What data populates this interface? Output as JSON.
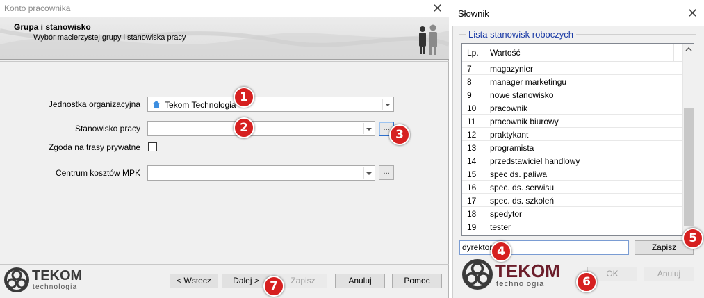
{
  "left_window": {
    "title": "Konto pracownika",
    "header": {
      "title": "Grupa i stanowisko",
      "subtitle": "Wybór macierzystej grupy i stanowiska pracy"
    },
    "fields": {
      "org_unit_label": "Jednostka organizacyjna",
      "org_unit_value": "Tekom Technologia",
      "position_label": "Stanowisko pracy",
      "position_value": "",
      "private_routes_label": "Zgoda na trasy prywatne",
      "cost_center_label": "Centrum kosztów MPK",
      "cost_center_value": "",
      "dots_label": "..."
    },
    "buttons": {
      "back": "< Wstecz",
      "next": "Dalej >",
      "save": "Zapisz",
      "cancel": "Anuluj",
      "help": "Pomoc"
    },
    "logo": {
      "name": "TEKOM",
      "sub": "technologia"
    }
  },
  "right_window": {
    "title": "Słownik",
    "group_title": "Lista stanowisk roboczych",
    "columns": {
      "lp": "Lp.",
      "value": "Wartość"
    },
    "rows": [
      {
        "lp": "7",
        "value": "magazynier"
      },
      {
        "lp": "8",
        "value": "manager marketingu"
      },
      {
        "lp": "9",
        "value": "nowe stanowisko"
      },
      {
        "lp": "10",
        "value": "pracownik"
      },
      {
        "lp": "11",
        "value": "pracownik biurowy"
      },
      {
        "lp": "12",
        "value": "praktykant"
      },
      {
        "lp": "13",
        "value": "programista"
      },
      {
        "lp": "14",
        "value": "przedstawiciel handlowy"
      },
      {
        "lp": "15",
        "value": "spec ds. paliwa"
      },
      {
        "lp": "16",
        "value": "spec. ds. serwisu"
      },
      {
        "lp": "17",
        "value": "spec. ds. szkoleń"
      },
      {
        "lp": "18",
        "value": "spedytor"
      },
      {
        "lp": "19",
        "value": "tester"
      }
    ],
    "new_value_input": "dyrektor",
    "buttons": {
      "save": "Zapisz",
      "ok": "OK",
      "cancel": "Anuluj"
    },
    "logo": {
      "name": "TEKOM",
      "sub": "technologia"
    }
  },
  "badges": [
    "1",
    "2",
    "3",
    "4",
    "5",
    "6",
    "7"
  ],
  "colors": {
    "badge": "#d62020",
    "group_title": "#1a3aa5",
    "accent_blue": "#2f6fcc"
  }
}
